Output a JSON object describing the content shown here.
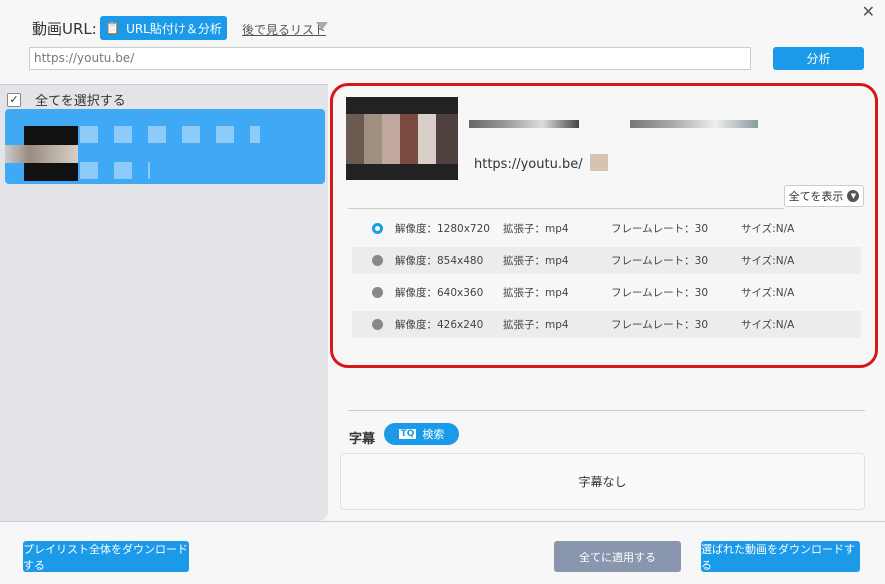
{
  "header": {
    "url_label": "動画URL:",
    "paste_button": "URL貼付け＆分析",
    "watch_later": "後で見るリスト",
    "url_value": "https://youtu.be/",
    "analyze_button": "分析",
    "close": "✕"
  },
  "sidebar": {
    "select_all": "全てを選択する",
    "checked": true
  },
  "video": {
    "link": "https://youtu.be/",
    "show_all": "全てを表示",
    "formats": [
      {
        "resolution": "解像度：1280x720",
        "ext": "拡張子：mp4",
        "fps": "フレームレート：30",
        "size": "サイズ:N/A",
        "selected": true
      },
      {
        "resolution": "解像度：854x480",
        "ext": "拡張子：mp4",
        "fps": "フレームレート：30",
        "size": "サイズ:N/A",
        "selected": false
      },
      {
        "resolution": "解像度：640x360",
        "ext": "拡張子：mp4",
        "fps": "フレームレート：30",
        "size": "サイズ:N/A",
        "selected": false
      },
      {
        "resolution": "解像度：426x240",
        "ext": "拡張子：mp4",
        "fps": "フレームレート：30",
        "size": "サイズ:N/A",
        "selected": false
      }
    ]
  },
  "subtitles": {
    "label": "字幕",
    "search_button": "検索",
    "empty": "字幕なし"
  },
  "footer": {
    "download_playlist": "プレイリスト全体をダウンロードする",
    "apply_all": "全てに適用する",
    "download_selected": "選ばれた動画をダウンロードする"
  },
  "colors": {
    "accent": "#1a9ae8",
    "highlight": "#d9161a",
    "disabled": "#8a96ae"
  }
}
